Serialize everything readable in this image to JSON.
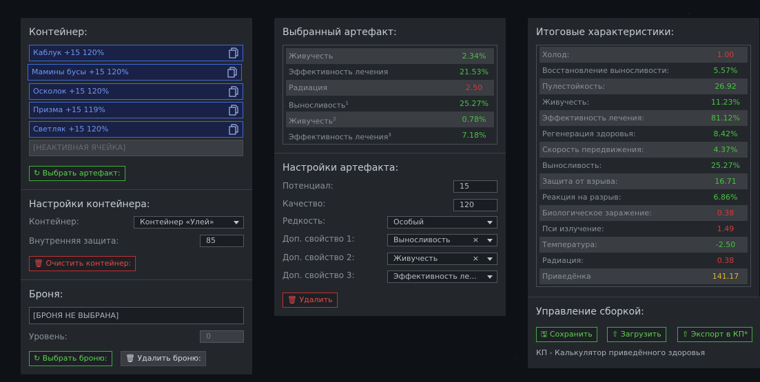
{
  "container_panel": {
    "title": "Контейнер:",
    "slots": [
      {
        "label": "Каблук +15 120%"
      },
      {
        "label": "Мамины бусы +15 120%"
      },
      {
        "label": "Осколок +15 120%"
      },
      {
        "label": "Призма +15 119%"
      },
      {
        "label": "Светляк +15 120%"
      }
    ],
    "inactive_slot": "[НЕАКТИВНАЯ ЯЧЕЙКА]",
    "select_artifact_button": "Выбрать артефакт:",
    "settings_title": "Настройки контейнера:",
    "container_label": "Контейнер:",
    "container_value": "Контейнер «Улей»",
    "protection_label": "Внутренняя защита:",
    "protection_value": "85",
    "clear_button": "Очистить контейнер:",
    "armor_title": "Броня:",
    "armor_value": "[БРОНЯ НЕ ВЫБРАНА]",
    "level_label": "Уровень:",
    "level_value": "0",
    "select_armor_button": "Выбрать броню:",
    "remove_armor_button": "Удалить броню:"
  },
  "artifact_panel": {
    "title": "Выбранный артефакт:",
    "stats": [
      {
        "name": "Живучесть",
        "sup": "",
        "value": "2.34%",
        "color": "green"
      },
      {
        "name": "Эффективность лечения",
        "sup": "",
        "value": "21.53%",
        "color": "green"
      },
      {
        "name": "Радиация",
        "sup": "",
        "value": "2.50",
        "color": "red"
      },
      {
        "name": "Выносливость",
        "sup": "1",
        "value": "25.27%",
        "color": "green"
      },
      {
        "name": "Живучесть",
        "sup": "2",
        "value": "0.78%",
        "color": "green"
      },
      {
        "name": "Эффективность лечения",
        "sup": "3",
        "value": "7.18%",
        "color": "green"
      }
    ],
    "settings_title": "Настройки артефакта:",
    "potential_label": "Потенциал:",
    "potential_value": "15",
    "quality_label": "Качество:",
    "quality_value": "120",
    "rarity_label": "Редкость:",
    "rarity_value": "Особый",
    "extra1_label": "Доп. свойство 1:",
    "extra1_value": "Выносливость",
    "extra2_label": "Доп. свойство 2:",
    "extra2_value": "Живучесть",
    "extra3_label": "Доп. свойство 3:",
    "extra3_value": "Эффективность ле...",
    "delete_button": "Удалить"
  },
  "totals_panel": {
    "title": "Итоговые характеристики:",
    "stats": [
      {
        "name": "Холод:",
        "value": "1.00",
        "color": "red"
      },
      {
        "name": "Восстановление выносливости:",
        "value": "5.57%",
        "color": "green"
      },
      {
        "name": "Пулестойкость:",
        "value": "26.92",
        "color": "green"
      },
      {
        "name": "Живучесть:",
        "value": "11.23%",
        "color": "green"
      },
      {
        "name": "Эффективность лечения:",
        "value": "81.12%",
        "color": "green"
      },
      {
        "name": "Регенерация здоровья:",
        "value": "8.42%",
        "color": "green"
      },
      {
        "name": "Скорость передвижения:",
        "value": "4.37%",
        "color": "green"
      },
      {
        "name": "Выносливость:",
        "value": "25.27%",
        "color": "green"
      },
      {
        "name": "Защита от взрыва:",
        "value": "16.71",
        "color": "green"
      },
      {
        "name": "Реакция на разрыв:",
        "value": "6.86%",
        "color": "green"
      },
      {
        "name": "Биологическое заражение:",
        "value": "0.38",
        "color": "red"
      },
      {
        "name": "Пси излучение:",
        "value": "1.49",
        "color": "red"
      },
      {
        "name": "Температура:",
        "value": "-2.50",
        "color": "green"
      },
      {
        "name": "Радиация:",
        "value": "0.38",
        "color": "red"
      },
      {
        "name": "Приведёнка",
        "value": "141.17",
        "color": "yellow"
      }
    ]
  },
  "build_panel": {
    "title": "Управление сборкой:",
    "save_button": "Сохранить",
    "load_button": "Загрузить",
    "export_button": "Экспорт в КП*",
    "footnote": "КП - Калькулятор приведённого здоровья"
  },
  "colors": {
    "green": "#45c43e",
    "red": "#d63a3a",
    "yellow": "#e0b533",
    "slot_border": "#3d6bd6"
  }
}
